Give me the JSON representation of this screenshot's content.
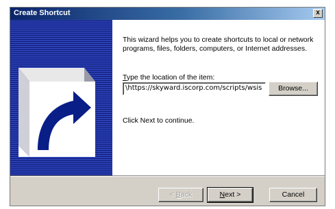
{
  "window": {
    "title": "Create Shortcut",
    "close_label": "x"
  },
  "wizard": {
    "intro": "This wizard helps you to create shortcuts to local or network programs, files, folders, computers, or Internet addresses.",
    "location_label_mnemonic": "T",
    "location_label_rest": "ype the location of the item:",
    "location_value": "\\https://skyward.iscorp.com/scripts/wsis",
    "browse_label": "Browse...",
    "hint": "Click Next to continue."
  },
  "buttons": {
    "back_mnemonic": "B",
    "back_prefix": "< ",
    "back_rest": "ack",
    "next_mnemonic": "N",
    "next_rest": "ext >",
    "cancel_label": "Cancel"
  }
}
